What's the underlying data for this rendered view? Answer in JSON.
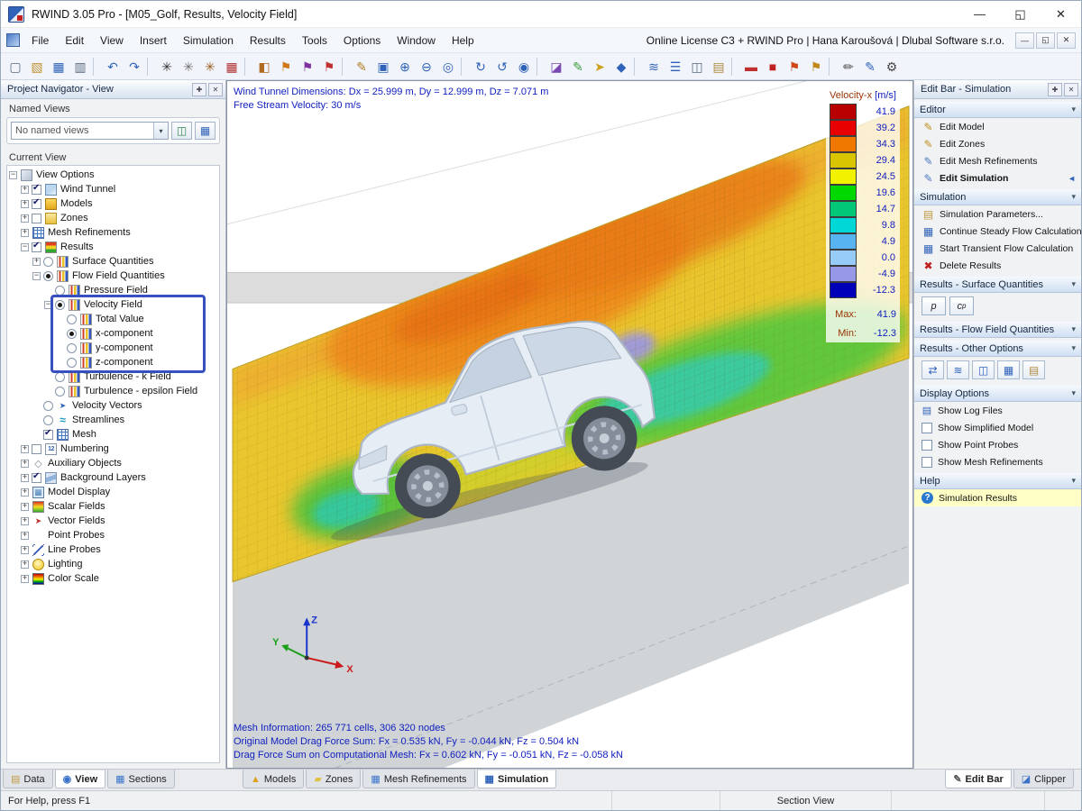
{
  "window": {
    "title": "RWIND 3.05 Pro - [M05_Golf, Results, Velocity Field]",
    "license_text": "Online License C3 + RWIND Pro | Hana Karoušová | Dlubal Software s.r.o."
  },
  "icons": {
    "pin": "✚",
    "close": "✕",
    "chevron_down": "▾",
    "combo_arrow": "▾",
    "edit_active_arrow": "◄",
    "minimize": "—",
    "restore": "◱",
    "help_q": "?"
  },
  "menubar": {
    "items": [
      "File",
      "Edit",
      "View",
      "Insert",
      "Simulation",
      "Results",
      "Tools",
      "Options",
      "Window",
      "Help"
    ]
  },
  "toolbar": {
    "buttons": [
      {
        "name": "new-model",
        "g": "▢",
        "st": "color:#5a6a7e"
      },
      {
        "name": "open-file",
        "g": "▧",
        "st": "color:#c09030"
      },
      {
        "name": "save",
        "g": "▦",
        "st": "color:#2f62b8"
      },
      {
        "name": "print",
        "g": "▥",
        "st": "color:#5a6a7e"
      },
      {
        "name": "separator",
        "g": "",
        "cls": "sep"
      },
      {
        "name": "undo",
        "g": "↶",
        "st": "color:#2f62b8"
      },
      {
        "name": "redo",
        "g": "↷",
        "st": "color:#2f62b8"
      },
      {
        "name": "separator",
        "g": "",
        "cls": "sep"
      },
      {
        "name": "generate-mesh",
        "g": "✳",
        "st": "color:#303030"
      },
      {
        "name": "mesh-settings",
        "g": "✳",
        "st": "color:#707070"
      },
      {
        "name": "shrink-wrap-mesh",
        "g": "✳",
        "st": "color:#9a5a20"
      },
      {
        "name": "wind-tunnel",
        "g": "▦",
        "st": "color:#b03030"
      },
      {
        "name": "separator",
        "g": "",
        "cls": "sep"
      },
      {
        "name": "model-check",
        "g": "◧",
        "st": "color:#b06a20"
      },
      {
        "name": "zones",
        "g": "⚑",
        "st": "color:#d07818"
      },
      {
        "name": "mesh-refinements",
        "g": "⚑",
        "st": "color:#8030a0"
      },
      {
        "name": "probes",
        "g": "⚑",
        "st": "color:#c03030"
      },
      {
        "name": "separator",
        "g": "",
        "cls": "sep"
      },
      {
        "name": "edit-mode",
        "g": "✎",
        "st": "color:#b08020"
      },
      {
        "name": "zoom-window",
        "g": "▣",
        "st": "color:#2f62b8"
      },
      {
        "name": "zoom-in",
        "g": "⊕",
        "st": "color:#2f62b8"
      },
      {
        "name": "zoom-out",
        "g": "⊖",
        "st": "color:#2f62b8"
      },
      {
        "name": "zoom-fit",
        "g": "◎",
        "st": "color:#2f62b8"
      },
      {
        "name": "separator",
        "g": "",
        "cls": "sep"
      },
      {
        "name": "rotate-view",
        "g": "↻",
        "st": "color:#2f62b8"
      },
      {
        "name": "previous-view",
        "g": "↺",
        "st": "color:#2f62b8"
      },
      {
        "name": "isometric-view",
        "g": "◉",
        "st": "color:#2f62b8"
      },
      {
        "name": "separator",
        "g": "",
        "cls": "sep"
      },
      {
        "name": "clipping-planes",
        "g": "◪",
        "st": "color:#7a48b0"
      },
      {
        "name": "display-properties",
        "g": "✎",
        "st": "color:#3a9a3a"
      },
      {
        "name": "move-tool",
        "g": "➤",
        "st": "color:#d0a020"
      },
      {
        "name": "solid-display",
        "g": "◆",
        "st": "color:#2f62b8"
      },
      {
        "name": "separator",
        "g": "",
        "cls": "sep"
      },
      {
        "name": "streamtracer",
        "g": "≋",
        "st": "color:#2f62b8"
      },
      {
        "name": "layers",
        "g": "☰",
        "st": "color:#2f62b8"
      },
      {
        "name": "duplicate-window",
        "g": "◫",
        "st": "color:#5a6a7e"
      },
      {
        "name": "clipboard",
        "g": "▤",
        "st": "color:#b08a40"
      },
      {
        "name": "separator",
        "g": "",
        "cls": "sep"
      },
      {
        "name": "eraser",
        "g": "▬",
        "st": "color:#c03030"
      },
      {
        "name": "stop-calculation",
        "g": "■",
        "st": "color:#c02020"
      },
      {
        "name": "flag-warning",
        "g": "⚑",
        "st": "color:#d04818"
      },
      {
        "name": "flag-note",
        "g": "⚑",
        "st": "color:#c08818"
      },
      {
        "name": "separator",
        "g": "",
        "cls": "sep"
      },
      {
        "name": "annotation-pen",
        "g": "✏",
        "st": "color:#444444"
      },
      {
        "name": "brush-style",
        "g": "✎",
        "st": "color:#2f62b8"
      },
      {
        "name": "settings",
        "g": "⚙",
        "st": "color:#444444"
      }
    ]
  },
  "navigator": {
    "title": "Project Navigator - View",
    "named_views_label": "Named Views",
    "combo_value": "No named views",
    "view_buttons": [
      {
        "name": "manage-views",
        "g": "◫",
        "st": "color:#2f8a4a"
      },
      {
        "name": "save-view",
        "g": "▦",
        "st": "color:#2f62b8"
      }
    ],
    "current_view_label": "Current View",
    "tree": [
      {
        "label": "View Options",
        "pad": "padding-left:2px",
        "exp": "minus",
        "ctrl": "none",
        "icon": "ic-viewopts"
      },
      {
        "label": "Wind Tunnel",
        "pad": "padding-left:15px",
        "exp": "plus",
        "ctrl": "cb on",
        "icon": "ic-tunnel"
      },
      {
        "label": "Models",
        "pad": "padding-left:15px",
        "exp": "plus",
        "ctrl": "cb on",
        "icon": "ic-models"
      },
      {
        "label": "Zones",
        "pad": "padding-left:15px",
        "exp": "plus",
        "ctrl": "cb off",
        "icon": "ic-zones"
      },
      {
        "label": "Mesh Refinements",
        "pad": "padding-left:15px",
        "exp": "plus",
        "ctrl": "none",
        "icon": "ic-mesh"
      },
      {
        "label": "Results",
        "pad": "padding-left:15px",
        "exp": "minus",
        "ctrl": "cb on",
        "icon": "ic-results"
      },
      {
        "label": "Surface Quantities",
        "pad": "padding-left:28px",
        "exp": "plus",
        "ctrl": "rb off",
        "icon": "ic-bars"
      },
      {
        "label": "Flow Field Quantities",
        "pad": "padding-left:28px",
        "exp": "minus",
        "ctrl": "rb on",
        "icon": "ic-bars"
      },
      {
        "label": "Pressure Field",
        "pad": "padding-left:41px",
        "exp": "noexp",
        "ctrl": "rb off",
        "icon": "ic-bars"
      },
      {
        "label": "Velocity Field",
        "pad": "padding-left:41px",
        "exp": "minus",
        "ctrl": "rb on",
        "icon": "ic-bars"
      },
      {
        "label": "Total Value",
        "pad": "padding-left:54px",
        "exp": "noexp",
        "ctrl": "rb off",
        "icon": "ic-bars"
      },
      {
        "label": "x-component",
        "pad": "padding-left:54px",
        "exp": "noexp",
        "ctrl": "rb on",
        "icon": "ic-bars"
      },
      {
        "label": "y-component",
        "pad": "padding-left:54px",
        "exp": "noexp",
        "ctrl": "rb off",
        "icon": "ic-bars"
      },
      {
        "label": "z-component",
        "pad": "padding-left:54px",
        "exp": "noexp",
        "ctrl": "rb off",
        "icon": "ic-bars"
      },
      {
        "label": "Turbulence - k Field",
        "pad": "padding-left:41px",
        "exp": "noexp",
        "ctrl": "rb off",
        "icon": "ic-bars"
      },
      {
        "label": "Turbulence - epsilon Field",
        "pad": "padding-left:41px",
        "exp": "noexp",
        "ctrl": "rb off",
        "icon": "ic-bars"
      },
      {
        "label": "Velocity Vectors",
        "pad": "padding-left:28px",
        "exp": "noexp",
        "ctrl": "rb off",
        "icon": "ic-vectors"
      },
      {
        "label": "Streamlines",
        "pad": "padding-left:28px",
        "exp": "noexp",
        "ctrl": "rb off",
        "icon": "ic-stream"
      },
      {
        "label": "Mesh",
        "pad": "padding-left:28px",
        "exp": "noexp",
        "ctrl": "cb on",
        "icon": "ic-mesh"
      },
      {
        "label": "Numbering",
        "pad": "padding-left:15px",
        "exp": "plus",
        "ctrl": "cb off",
        "icon": "ic-123"
      },
      {
        "label": "Auxiliary Objects",
        "pad": "padding-left:15px",
        "exp": "plus",
        "ctrl": "none",
        "icon": "ic-aux"
      },
      {
        "label": "Background Layers",
        "pad": "padding-left:15px",
        "exp": "plus",
        "ctrl": "cb on",
        "icon": "ic-layers"
      },
      {
        "label": "Model Display",
        "pad": "padding-left:15px",
        "exp": "plus",
        "ctrl": "none",
        "icon": "ic-display"
      },
      {
        "label": "Scalar Fields",
        "pad": "padding-left:15px",
        "exp": "plus",
        "ctrl": "none",
        "icon": "ic-scalar"
      },
      {
        "label": "Vector Fields",
        "pad": "padding-left:15px",
        "exp": "plus",
        "ctrl": "none",
        "icon": "ic-vector2"
      },
      {
        "label": "Point Probes",
        "pad": "padding-left:15px",
        "exp": "plus",
        "ctrl": "none",
        "icon": "ic-point"
      },
      {
        "label": "Line Probes",
        "pad": "padding-left:15px",
        "exp": "plus",
        "ctrl": "none",
        "icon": "ic-line"
      },
      {
        "label": "Lighting",
        "pad": "padding-left:15px",
        "exp": "plus",
        "ctrl": "none",
        "icon": "ic-light"
      },
      {
        "label": "Color Scale",
        "pad": "padding-left:15px",
        "exp": "plus",
        "ctrl": "none",
        "icon": "ic-colorscale"
      }
    ]
  },
  "viewport": {
    "info_line1": "Wind Tunnel Dimensions: Dx = 25.999 m, Dy = 12.999 m, Dz = 7.071 m",
    "info_line2": "Free Stream Velocity: 30 m/s",
    "mesh_info": "Mesh Information: 265 771 cells, 306 320 nodes",
    "drag_original": "Original Model Drag Force Sum: Fx = 0.535 kN, Fy = -0.044 kN, Fz = 0.504 kN",
    "drag_mesh": "Drag Force Sum on Computational Mesh: Fx = 0.602 kN, Fy = -0.051 kN, Fz = -0.058 kN",
    "axes": {
      "x": "X",
      "y": "Y",
      "z": "Z"
    },
    "legend": {
      "title": "Velocity-x",
      "unit": "[m/s]",
      "entries": [
        {
          "v": "41.9",
          "st": "background:#b80000"
        },
        {
          "v": "39.2",
          "st": "background:#e80000"
        },
        {
          "v": "34.3",
          "st": "background:#f07800"
        },
        {
          "v": "29.4",
          "st": "background:#d8c400"
        },
        {
          "v": "24.5",
          "st": "background:#f2f200"
        },
        {
          "v": "19.6",
          "st": "background:#00d800"
        },
        {
          "v": "14.7",
          "st": "background:#00c878"
        },
        {
          "v": "9.8",
          "st": "background:#00d8d8"
        },
        {
          "v": "4.9",
          "st": "background:#58b4f0"
        },
        {
          "v": "0.0",
          "st": "background:#98ccf8"
        },
        {
          "v": "-4.9",
          "st": "background:#9898e8"
        },
        {
          "v": "-12.3",
          "st": "background:#0000b8"
        }
      ],
      "max_label": "Max:",
      "max_value": "41.9",
      "min_label": "Min:",
      "min_value": "-12.3"
    }
  },
  "editbar": {
    "title": "Edit Bar - Simulation",
    "sections": {
      "editor": {
        "title": "Editor",
        "items": [
          {
            "label": "Edit Model",
            "g": "✎",
            "st": "color:#c09020"
          },
          {
            "label": "Edit Zones",
            "g": "✎",
            "st": "color:#c09020"
          },
          {
            "label": "Edit Mesh Refinements",
            "g": "✎",
            "st": "color:#4a7ac0"
          },
          {
            "label": "Edit Simulation",
            "g": "✎",
            "st": "color:#4a7ac0",
            "cls": "active",
            "arrow": "◄"
          }
        ]
      },
      "simulation": {
        "title": "Simulation",
        "items": [
          {
            "label": "Simulation Parameters...",
            "g": "▤",
            "st": "color:#c09a40"
          },
          {
            "label": "Continue Steady Flow Calculation",
            "g": "▦",
            "st": "color:#2f62b8"
          },
          {
            "label": "Start Transient Flow Calculation",
            "g": "▦",
            "st": "color:#2f62b8"
          },
          {
            "label": "Delete Results",
            "g": "✖",
            "st": "color:#c02020"
          }
        ]
      },
      "surface": {
        "title": "Results - Surface Quantities",
        "p": "p",
        "cp_main": "c",
        "cp_sub": "p"
      },
      "flow": {
        "title": "Results - Flow Field Quantities"
      },
      "other": {
        "title": "Results - Other Options",
        "buttons": [
          {
            "name": "flow-animation",
            "g": "⇄",
            "st": "color:#2f62b8"
          },
          {
            "name": "streamline-options",
            "g": "≋",
            "st": "color:#2f62b8"
          },
          {
            "name": "value-display",
            "g": "◫",
            "st": "color:#2f62b8"
          },
          {
            "name": "result-table",
            "g": "▦",
            "st": "color:#2f62b8"
          },
          {
            "name": "export-results",
            "g": "▤",
            "st": "color:#b08a40"
          }
        ]
      },
      "display": {
        "title": "Display Options",
        "items": [
          {
            "label": "Show Log Files",
            "cls": "opt-icon",
            "g": "▤"
          },
          {
            "label": "Show Simplified Model",
            "cls": "opt-cb",
            "g": ""
          },
          {
            "label": "Show Point Probes",
            "cls": "opt-cb",
            "g": ""
          },
          {
            "label": "Show Mesh Refinements",
            "cls": "opt-cb",
            "g": ""
          }
        ]
      },
      "help": {
        "title": "Help",
        "item": "Simulation Results"
      }
    }
  },
  "tabs": {
    "left": [
      {
        "label": "Data",
        "g": "▤",
        "st": "color:#c09a40"
      },
      {
        "label": "View",
        "g": "◉",
        "st": "color:#3a72c8",
        "cls": "sel"
      },
      {
        "label": "Sections",
        "g": "▦",
        "st": "color:#3a72c8"
      }
    ],
    "center": [
      {
        "label": "Models",
        "g": "▲",
        "st": "color:#e0a020"
      },
      {
        "label": "Zones",
        "g": "▰",
        "st": "color:#e0c040"
      },
      {
        "label": "Mesh Refinements",
        "g": "▦",
        "st": "color:#3a72c8"
      },
      {
        "label": "Simulation",
        "g": "▦",
        "st": "color:#2f62b8",
        "cls": "sel"
      }
    ],
    "right": [
      {
        "label": "Edit Bar",
        "g": "✎",
        "st": "color:#555555",
        "cls": "sel"
      },
      {
        "label": "Clipper",
        "g": "◪",
        "st": "color:#3a72c8"
      }
    ]
  },
  "statusbar": {
    "help_text": "For Help, press F1",
    "section_view": "Section View"
  }
}
